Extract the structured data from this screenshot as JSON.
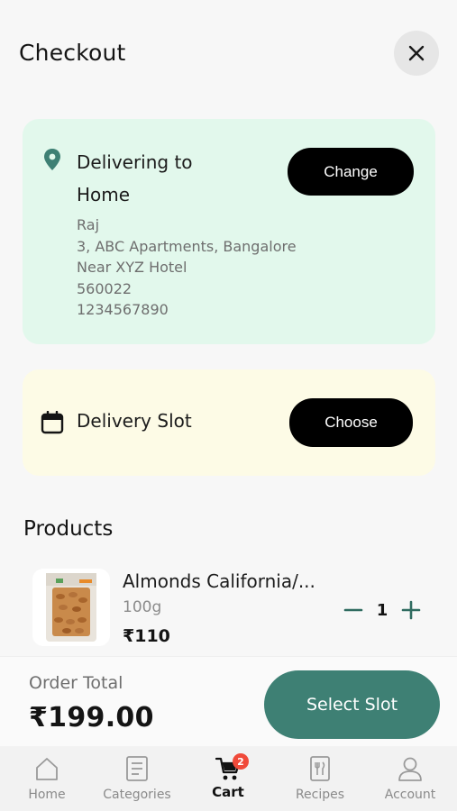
{
  "header": {
    "title": "Checkout"
  },
  "address": {
    "title": "Delivering to",
    "label": "Home",
    "change_label": "Change",
    "lines": [
      "Raj",
      "3, ABC Apartments, Bangalore",
      "Near XYZ Hotel",
      "560022",
      "1234567890"
    ]
  },
  "slot": {
    "title": "Delivery Slot",
    "choose_label": "Choose"
  },
  "products": {
    "heading": "Products",
    "items": [
      {
        "name": "Almonds California/...",
        "weight": "100g",
        "price": "₹110",
        "quantity": "1"
      }
    ]
  },
  "order": {
    "total_label": "Order Total",
    "total_amount": "₹199.00",
    "select_slot_label": "Select Slot"
  },
  "nav": {
    "items": [
      {
        "label": "Home",
        "icon": "home-icon"
      },
      {
        "label": "Categories",
        "icon": "categories-icon"
      },
      {
        "label": "Cart",
        "icon": "cart-icon",
        "badge": "2",
        "active": true
      },
      {
        "label": "Recipes",
        "icon": "recipes-icon"
      },
      {
        "label": "Account",
        "icon": "account-icon"
      }
    ]
  },
  "colors": {
    "address_card_bg": "#e2f8ec",
    "slot_card_bg": "#fdfbe6",
    "accent_teal": "#3e8074",
    "badge_red": "#f04a3a"
  }
}
